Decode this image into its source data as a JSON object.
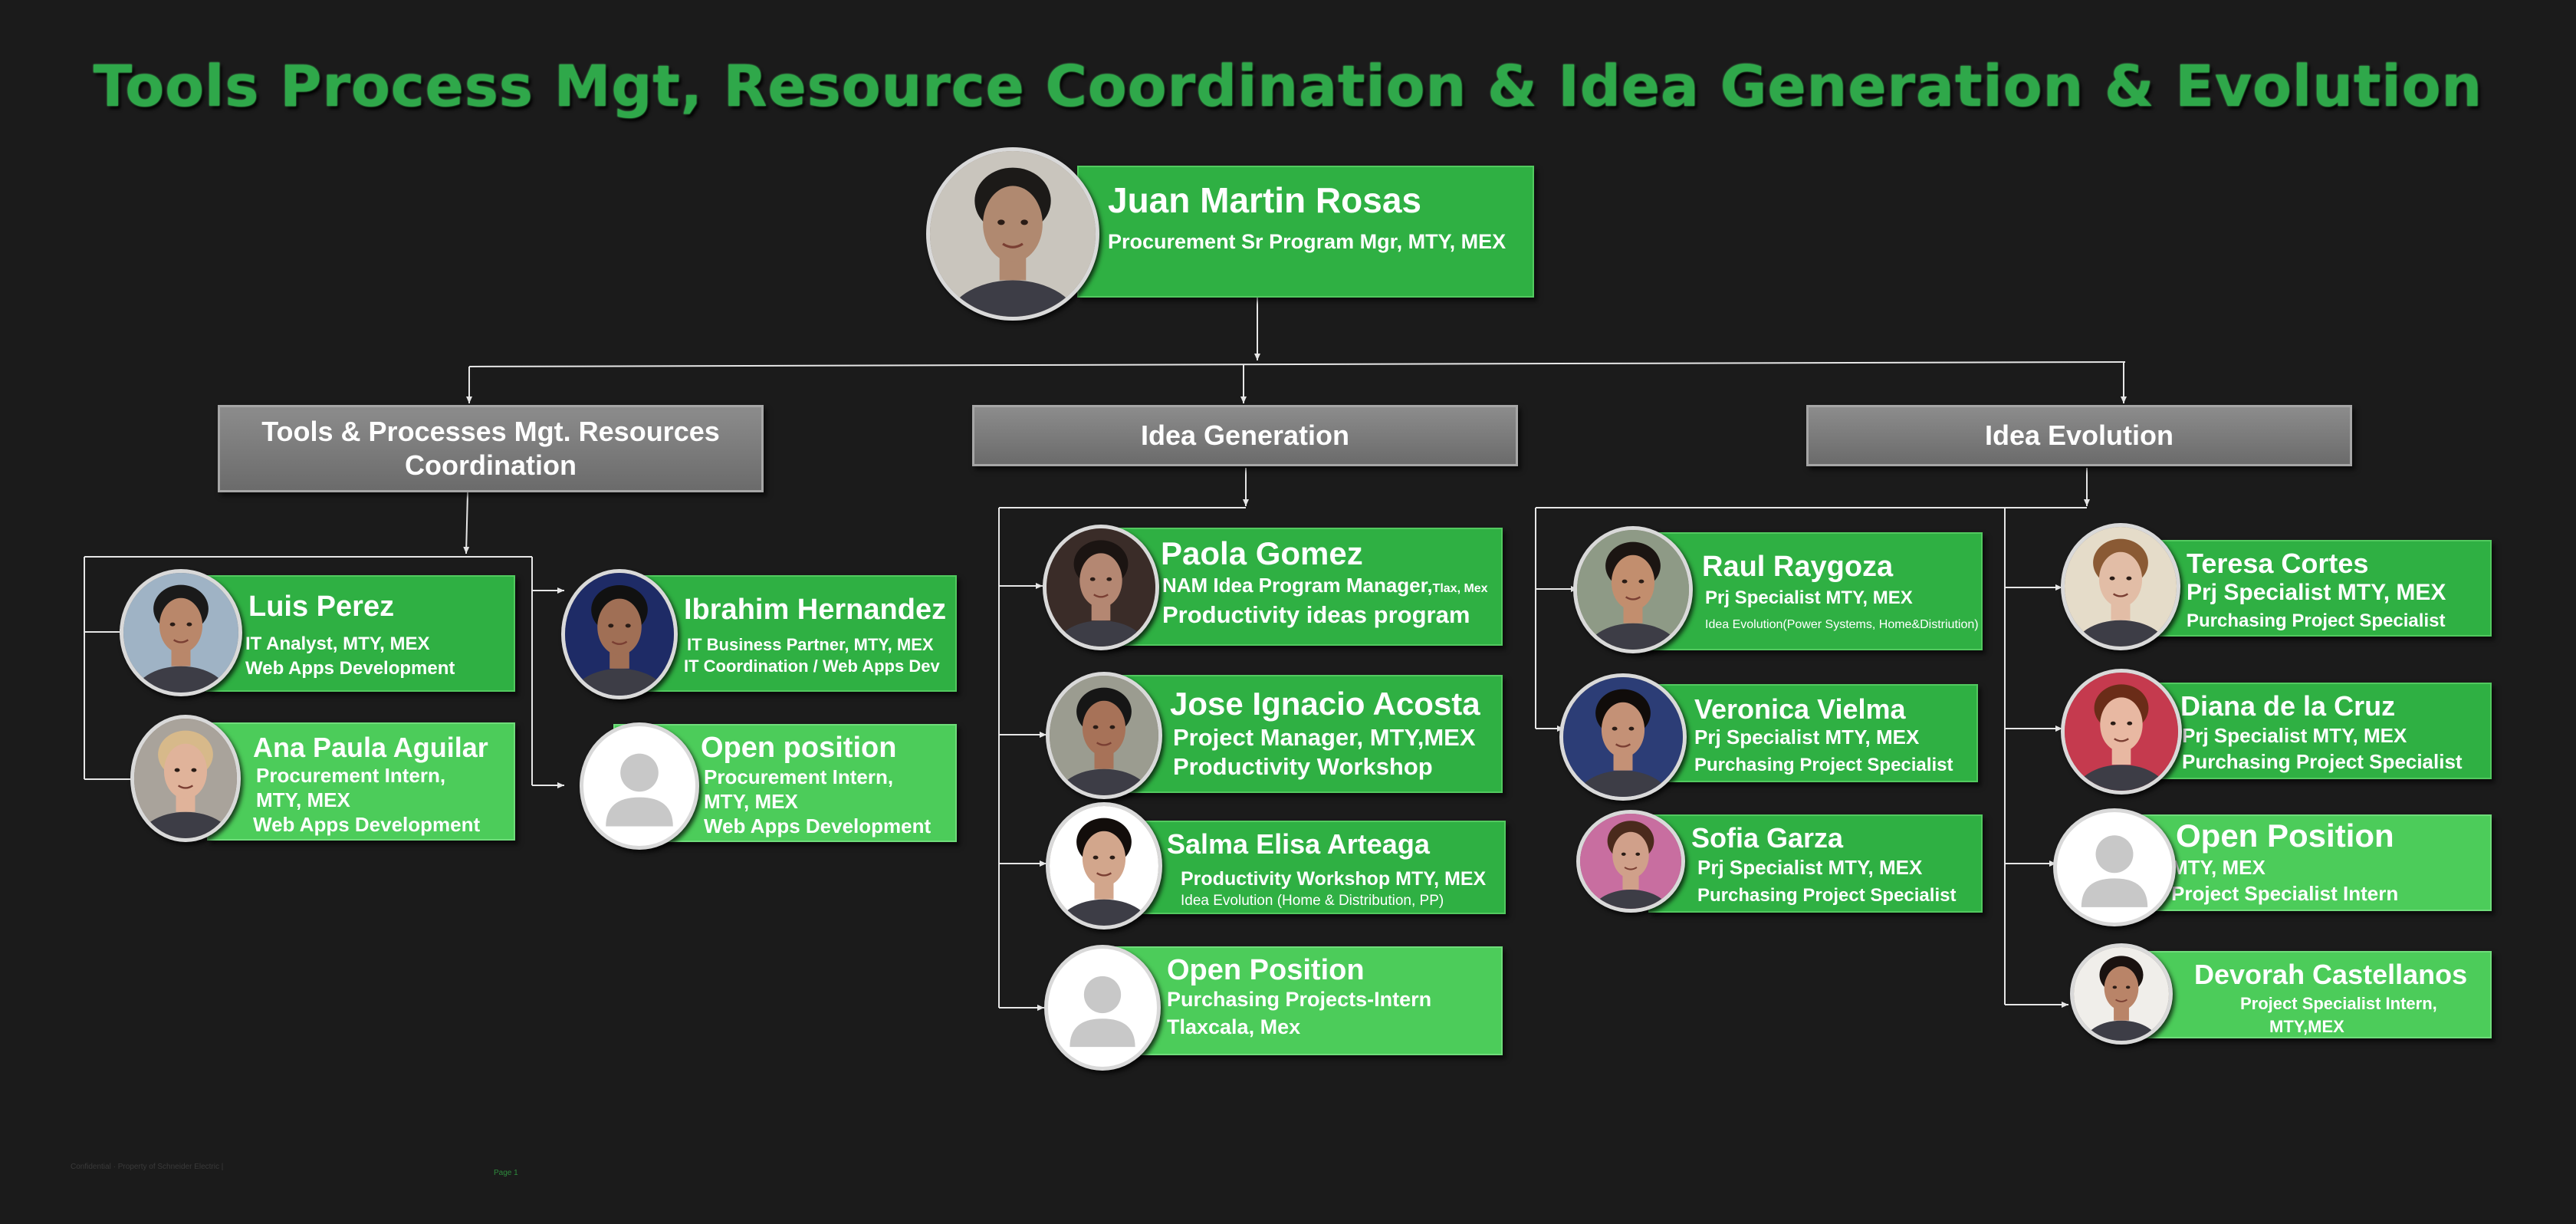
{
  "title": "Tools Process Mgt, Resource Coordination & Idea Generation & Evolution",
  "leader": {
    "name": "Juan Martin Rosas",
    "role": "Procurement Sr Program Mgr,  MTY, MEX"
  },
  "departments": {
    "tools": {
      "label_1": "Tools & Processes Mgt. Resources",
      "label_2": "Coordination"
    },
    "generation": {
      "label": "Idea Generation"
    },
    "evolution": {
      "label": "Idea Evolution"
    }
  },
  "tools_team": {
    "luis": {
      "name": "Luis Perez",
      "line1": "IT Analyst, MTY, MEX",
      "line2": "Web Apps Development"
    },
    "ana": {
      "name": "Ana Paula Aguilar",
      "line1": "Procurement Intern,",
      "line2": "MTY, MEX",
      "line3": "Web Apps Development"
    },
    "ibrahim": {
      "name": "Ibrahim Hernandez",
      "line1": "IT Business Partner, MTY, MEX",
      "line2": "IT Coordination  / Web Apps Dev"
    },
    "open": {
      "name": "Open position",
      "line1": "Procurement Intern,",
      "line2": "MTY, MEX",
      "line3": "Web Apps Development"
    }
  },
  "generation_team": {
    "paola": {
      "name": "Paola Gomez",
      "line1": "NAM Idea Program Manager,",
      "line1_small": "Tlax, Mex",
      "line2": "Productivity ideas program"
    },
    "jose": {
      "name": "Jose Ignacio Acosta",
      "line1": "Project Manager, MTY,MEX",
      "line2": "Productivity Workshop"
    },
    "salma": {
      "name": "Salma Elisa Arteaga",
      "line1": "Productivity Workshop MTY, MEX",
      "line2": "Idea Evolution (Home & Distribution, PP)"
    },
    "open": {
      "name": "Open Position",
      "line1": "Purchasing Projects-Intern",
      "line2": "Tlaxcala, Mex"
    }
  },
  "evolution_team": {
    "raul": {
      "name": "Raul Raygoza",
      "line1": "Prj Specialist MTY, MEX",
      "line2": "Idea Evolution(Power Systems, Home&Distriution)"
    },
    "veronica": {
      "name": "Veronica Vielma",
      "line1": "Prj Specialist MTY, MEX",
      "line2": "Purchasing Project Specialist"
    },
    "sofia": {
      "name": "Sofia Garza",
      "line1": "Prj Specialist MTY, MEX",
      "line2": "Purchasing Project Specialist"
    },
    "teresa": {
      "name": "Teresa Cortes",
      "line1": "Prj Specialist MTY, MEX",
      "line2": "Purchasing Project Specialist"
    },
    "diana": {
      "name": "Diana de la Cruz",
      "line1": "Prj Specialist MTY, MEX",
      "line2": "Purchasing Project Specialist"
    },
    "open": {
      "name": "Open Position",
      "line1": "MTY, MEX",
      "line2": "Project Specialist Intern"
    },
    "devorah": {
      "name": "Devorah Castellanos",
      "line1": "Project Specialist Intern,",
      "line2": "MTY,MEX"
    }
  },
  "footer": {
    "classification": "Confidential · Property of Schneider Electric |",
    "page": "Page 1"
  },
  "colors": {
    "title": "#2fa84a",
    "card": "#2fb043",
    "card_light": "#4ccc5a",
    "header": "#7a7a7a",
    "background": "#1b1b1b"
  },
  "icons": {
    "portrait": "person-photo",
    "placeholder": "person-silhouette-icon"
  }
}
